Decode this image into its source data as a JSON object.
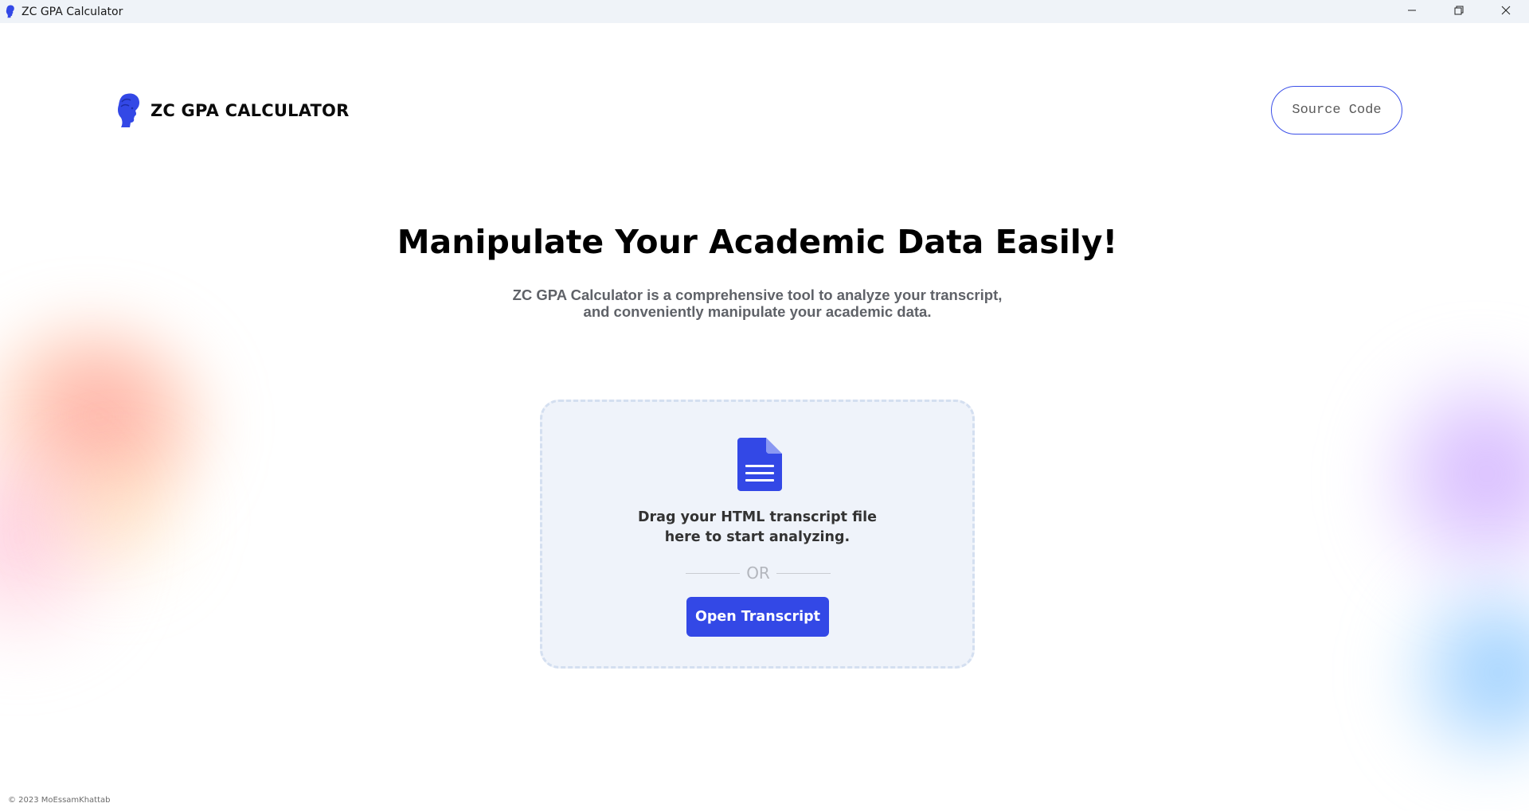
{
  "window": {
    "title": "ZC GPA Calculator",
    "icon": "zc-head-icon"
  },
  "window_controls": {
    "minimize_icon": "minimize-icon",
    "restore_icon": "restore-icon",
    "close_icon": "close-icon"
  },
  "header": {
    "brand": "ZC GPA CALCULATOR",
    "logo_icon": "zc-head-logo-icon",
    "source_code_label": "Source Code"
  },
  "hero": {
    "title": "Manipulate Your Academic Data Easily!",
    "subtitle_line1": "ZC GPA Calculator is  a comprehensive tool to analyze your transcript,",
    "subtitle_line2": "and conveniently manipulate your academic data."
  },
  "dropzone": {
    "icon": "document-icon",
    "text_line1": "Drag your HTML transcript file",
    "text_line2": "here to start analyzing.",
    "or_label": "OR",
    "button_label": "Open Transcript"
  },
  "footer": {
    "copyright": "© 2023 MoEssamKhattab"
  },
  "colors": {
    "accent": "#3348e6",
    "titlebar_bg": "#eff3f8",
    "dropzone_bg": "#eff3fa"
  }
}
